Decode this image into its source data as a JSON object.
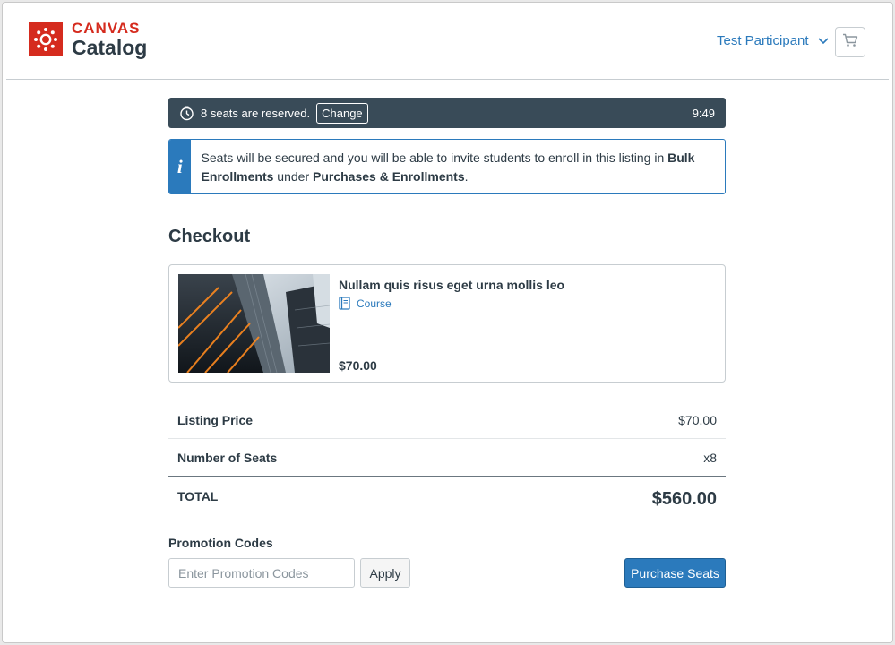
{
  "header": {
    "logo_top": "CANVAS",
    "logo_bottom": "Catalog",
    "user_name": "Test Participant",
    "icons": {
      "logo": "canvas-logo-icon",
      "user_menu": "chevron-down-icon",
      "cart": "cart-icon"
    }
  },
  "reservation": {
    "message": "8 seats are reserved.",
    "change_label": "Change",
    "time_remaining": "9:49",
    "icon": "stopwatch-icon"
  },
  "info": {
    "icon_glyph": "i",
    "text_1": "Seats will be secured and you will be able to invite students to enroll in this listing in ",
    "bold_1": "Bulk Enrollments",
    "text_2": " under ",
    "bold_2": "Purchases & Enrollments",
    "text_3": "."
  },
  "checkout": {
    "title": "Checkout",
    "product": {
      "name": "Nullam quis risus eget urna mollis leo",
      "type": "Course",
      "type_icon": "book-icon",
      "price": "$70.00",
      "image": "building-skyscraper-image"
    },
    "summary": {
      "listing_label": "Listing Price",
      "listing_value": "$70.00",
      "seats_label": "Number of Seats",
      "seats_value": "x8",
      "total_label": "TOTAL",
      "total_value": "$560.00"
    }
  },
  "promo": {
    "label": "Promotion Codes",
    "placeholder": "Enter Promotion Codes",
    "value": "",
    "apply_label": "Apply"
  },
  "purchase_label": "Purchase Seats",
  "colors": {
    "brand_red": "#d52b1e",
    "link_blue": "#2b7abc",
    "timer_bar": "#394b58",
    "text": "#2d3b45"
  }
}
